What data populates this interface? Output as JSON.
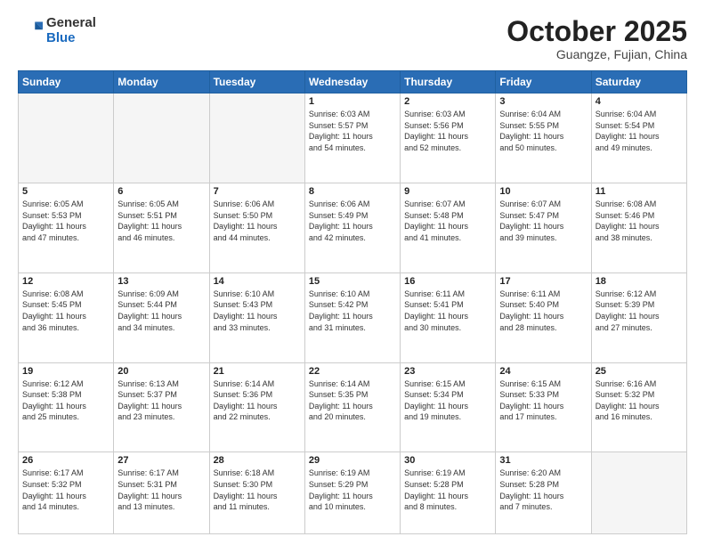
{
  "header": {
    "logo_general": "General",
    "logo_blue": "Blue",
    "month": "October 2025",
    "location": "Guangze, Fujian, China"
  },
  "weekdays": [
    "Sunday",
    "Monday",
    "Tuesday",
    "Wednesday",
    "Thursday",
    "Friday",
    "Saturday"
  ],
  "weeks": [
    [
      {
        "day": "",
        "info": ""
      },
      {
        "day": "",
        "info": ""
      },
      {
        "day": "",
        "info": ""
      },
      {
        "day": "1",
        "info": "Sunrise: 6:03 AM\nSunset: 5:57 PM\nDaylight: 11 hours\nand 54 minutes."
      },
      {
        "day": "2",
        "info": "Sunrise: 6:03 AM\nSunset: 5:56 PM\nDaylight: 11 hours\nand 52 minutes."
      },
      {
        "day": "3",
        "info": "Sunrise: 6:04 AM\nSunset: 5:55 PM\nDaylight: 11 hours\nand 50 minutes."
      },
      {
        "day": "4",
        "info": "Sunrise: 6:04 AM\nSunset: 5:54 PM\nDaylight: 11 hours\nand 49 minutes."
      }
    ],
    [
      {
        "day": "5",
        "info": "Sunrise: 6:05 AM\nSunset: 5:53 PM\nDaylight: 11 hours\nand 47 minutes."
      },
      {
        "day": "6",
        "info": "Sunrise: 6:05 AM\nSunset: 5:51 PM\nDaylight: 11 hours\nand 46 minutes."
      },
      {
        "day": "7",
        "info": "Sunrise: 6:06 AM\nSunset: 5:50 PM\nDaylight: 11 hours\nand 44 minutes."
      },
      {
        "day": "8",
        "info": "Sunrise: 6:06 AM\nSunset: 5:49 PM\nDaylight: 11 hours\nand 42 minutes."
      },
      {
        "day": "9",
        "info": "Sunrise: 6:07 AM\nSunset: 5:48 PM\nDaylight: 11 hours\nand 41 minutes."
      },
      {
        "day": "10",
        "info": "Sunrise: 6:07 AM\nSunset: 5:47 PM\nDaylight: 11 hours\nand 39 minutes."
      },
      {
        "day": "11",
        "info": "Sunrise: 6:08 AM\nSunset: 5:46 PM\nDaylight: 11 hours\nand 38 minutes."
      }
    ],
    [
      {
        "day": "12",
        "info": "Sunrise: 6:08 AM\nSunset: 5:45 PM\nDaylight: 11 hours\nand 36 minutes."
      },
      {
        "day": "13",
        "info": "Sunrise: 6:09 AM\nSunset: 5:44 PM\nDaylight: 11 hours\nand 34 minutes."
      },
      {
        "day": "14",
        "info": "Sunrise: 6:10 AM\nSunset: 5:43 PM\nDaylight: 11 hours\nand 33 minutes."
      },
      {
        "day": "15",
        "info": "Sunrise: 6:10 AM\nSunset: 5:42 PM\nDaylight: 11 hours\nand 31 minutes."
      },
      {
        "day": "16",
        "info": "Sunrise: 6:11 AM\nSunset: 5:41 PM\nDaylight: 11 hours\nand 30 minutes."
      },
      {
        "day": "17",
        "info": "Sunrise: 6:11 AM\nSunset: 5:40 PM\nDaylight: 11 hours\nand 28 minutes."
      },
      {
        "day": "18",
        "info": "Sunrise: 6:12 AM\nSunset: 5:39 PM\nDaylight: 11 hours\nand 27 minutes."
      }
    ],
    [
      {
        "day": "19",
        "info": "Sunrise: 6:12 AM\nSunset: 5:38 PM\nDaylight: 11 hours\nand 25 minutes."
      },
      {
        "day": "20",
        "info": "Sunrise: 6:13 AM\nSunset: 5:37 PM\nDaylight: 11 hours\nand 23 minutes."
      },
      {
        "day": "21",
        "info": "Sunrise: 6:14 AM\nSunset: 5:36 PM\nDaylight: 11 hours\nand 22 minutes."
      },
      {
        "day": "22",
        "info": "Sunrise: 6:14 AM\nSunset: 5:35 PM\nDaylight: 11 hours\nand 20 minutes."
      },
      {
        "day": "23",
        "info": "Sunrise: 6:15 AM\nSunset: 5:34 PM\nDaylight: 11 hours\nand 19 minutes."
      },
      {
        "day": "24",
        "info": "Sunrise: 6:15 AM\nSunset: 5:33 PM\nDaylight: 11 hours\nand 17 minutes."
      },
      {
        "day": "25",
        "info": "Sunrise: 6:16 AM\nSunset: 5:32 PM\nDaylight: 11 hours\nand 16 minutes."
      }
    ],
    [
      {
        "day": "26",
        "info": "Sunrise: 6:17 AM\nSunset: 5:32 PM\nDaylight: 11 hours\nand 14 minutes."
      },
      {
        "day": "27",
        "info": "Sunrise: 6:17 AM\nSunset: 5:31 PM\nDaylight: 11 hours\nand 13 minutes."
      },
      {
        "day": "28",
        "info": "Sunrise: 6:18 AM\nSunset: 5:30 PM\nDaylight: 11 hours\nand 11 minutes."
      },
      {
        "day": "29",
        "info": "Sunrise: 6:19 AM\nSunset: 5:29 PM\nDaylight: 11 hours\nand 10 minutes."
      },
      {
        "day": "30",
        "info": "Sunrise: 6:19 AM\nSunset: 5:28 PM\nDaylight: 11 hours\nand 8 minutes."
      },
      {
        "day": "31",
        "info": "Sunrise: 6:20 AM\nSunset: 5:28 PM\nDaylight: 11 hours\nand 7 minutes."
      },
      {
        "day": "",
        "info": ""
      }
    ]
  ]
}
